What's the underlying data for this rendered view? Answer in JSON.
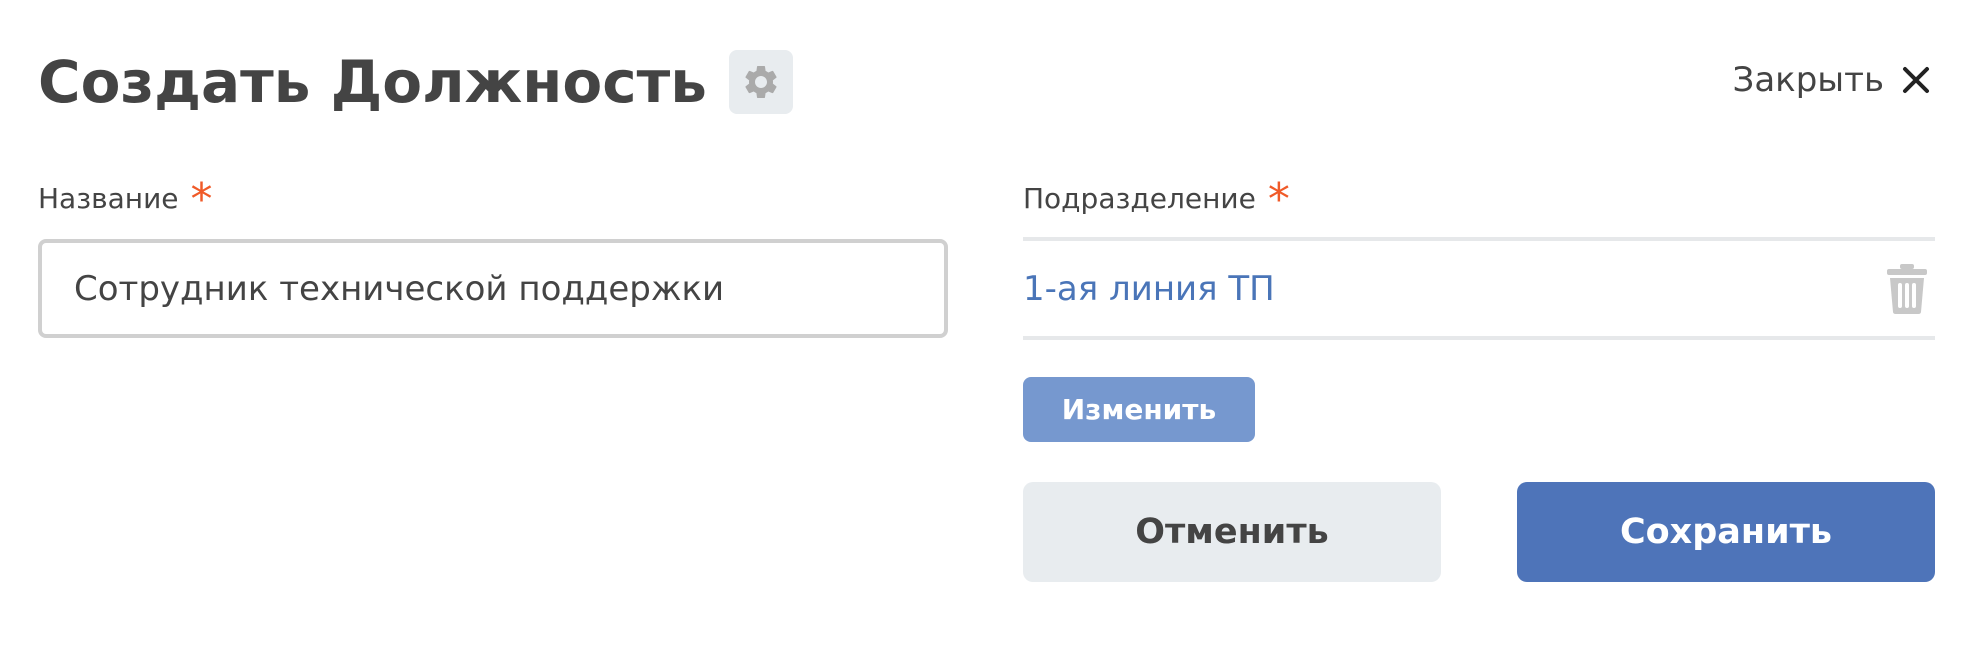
{
  "header": {
    "title": "Создать Должность",
    "settings_icon": "gear-icon"
  },
  "close": {
    "label": "Закрыть",
    "icon": "close-icon"
  },
  "form": {
    "name": {
      "label": "Название",
      "required_mark": "*",
      "value": "Сотрудник технической поддержки"
    },
    "department": {
      "label": "Подразделение",
      "required_mark": "*",
      "value": "1-ая линия ТП",
      "remove_icon": "trash-icon",
      "change_label": "Изменить"
    }
  },
  "actions": {
    "cancel_label": "Отменить",
    "save_label": "Сохранить"
  },
  "colors": {
    "accent": "#4e74b9",
    "accent_light": "#7698cf",
    "link": "#4a75b8",
    "required": "#f05a28",
    "text": "#444444",
    "muted_bg": "#e8ecef"
  }
}
